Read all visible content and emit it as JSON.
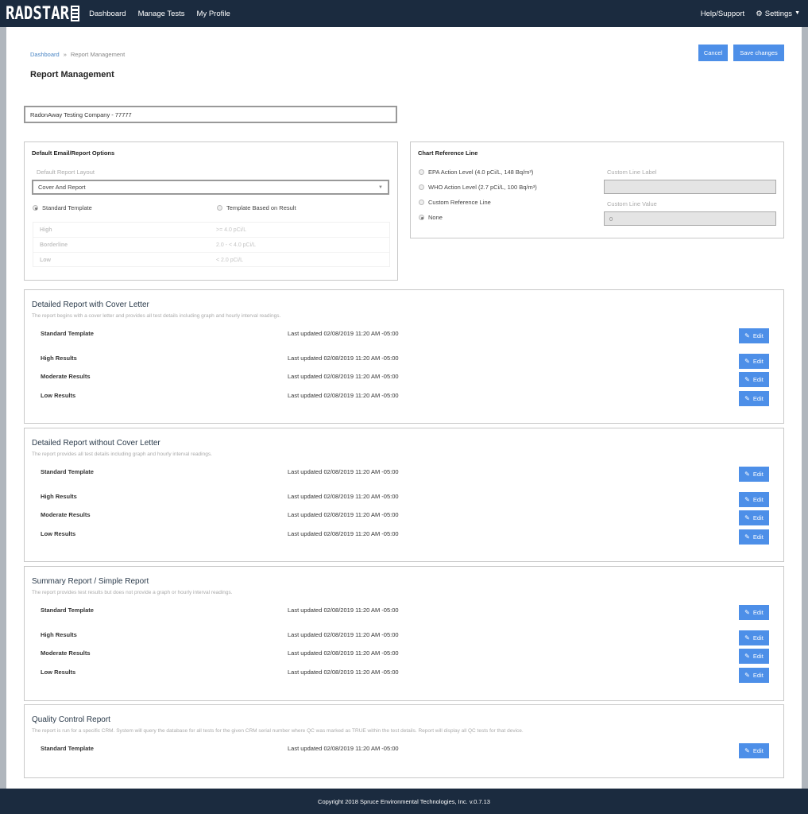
{
  "navbar": {
    "logo_text": "RADSTAR",
    "links": [
      "Dashboard",
      "Manage Tests",
      "My Profile"
    ],
    "help_label": "Help/Support",
    "settings_label": "Settings"
  },
  "breadcrumb": {
    "home": "Dashboard",
    "separator": "»",
    "current": "Report Management"
  },
  "page_title": "Report Management",
  "actions": {
    "cancel_label": "Cancel",
    "save_label": "Save changes"
  },
  "company_field": {
    "value": "RadonAway Testing Company - 77777"
  },
  "email_options": {
    "title": "Default Email/Report Options",
    "layout_label": "Default Report Layout",
    "layout_value": "Cover And Report",
    "radio_standard": "Standard Template",
    "radio_result_based": "Template Based on Result",
    "selected": "Standard Template",
    "thresholds": [
      {
        "name": "High",
        "value": ">= 4.0 pCi/L"
      },
      {
        "name": "Borderline",
        "value": "2.0 - < 4.0 pCi/L"
      },
      {
        "name": "Low",
        "value": "< 2.0 pCi/L"
      }
    ]
  },
  "chart_reference": {
    "title": "Chart Reference Line",
    "options": [
      "EPA Action Level (4.0 pCi/L, 148 Bq/m³)",
      "WHO Action Level (2.7 pCi/L, 100 Bq/m³)",
      "Custom Reference Line",
      "None"
    ],
    "selected": "None",
    "custom_label_label": "Custom Line Label",
    "custom_label_value": "",
    "custom_value_label": "Custom Line Value",
    "custom_value_value": "0"
  },
  "reports": [
    {
      "title": "Detailed Report with Cover Letter",
      "description": "The report begins with a cover letter and provides all test details including graph and hourly interval readings.",
      "templates": [
        {
          "name": "Standard Template",
          "updated": "Last updated 02/08/2019 11:20 AM -05:00"
        },
        {
          "name": "High Results",
          "updated": "Last updated 02/08/2019 11:20 AM -05:00"
        },
        {
          "name": "Moderate Results",
          "updated": "Last updated 02/08/2019 11:20 AM -05:00"
        },
        {
          "name": "Low Results",
          "updated": "Last updated 02/08/2019 11:20 AM -05:00"
        }
      ]
    },
    {
      "title": "Detailed Report without Cover Letter",
      "description": "The report provides all test details including graph and hourly interval readings.",
      "templates": [
        {
          "name": "Standard Template",
          "updated": "Last updated 02/08/2019 11:20 AM -05:00"
        },
        {
          "name": "High Results",
          "updated": "Last updated 02/08/2019 11:20 AM -05:00"
        },
        {
          "name": "Moderate Results",
          "updated": "Last updated 02/08/2019 11:20 AM -05:00"
        },
        {
          "name": "Low Results",
          "updated": "Last updated 02/08/2019 11:20 AM -05:00"
        }
      ]
    },
    {
      "title": "Summary Report / Simple Report",
      "description": "The report provides test results but does not provide a graph or hourly interval readings.",
      "templates": [
        {
          "name": "Standard Template",
          "updated": "Last updated 02/08/2019 11:20 AM -05:00"
        },
        {
          "name": "High Results",
          "updated": "Last updated 02/08/2019 11:20 AM -05:00"
        },
        {
          "name": "Moderate Results",
          "updated": "Last updated 02/08/2019 11:20 AM -05:00"
        },
        {
          "name": "Low Results",
          "updated": "Last updated 02/08/2019 11:20 AM -05:00"
        }
      ]
    },
    {
      "title": "Quality Control Report",
      "description": "The report is run for a specific CRM. System will query the database for all tests for the given CRM serial number where QC was marked as TRUE within the test details. Report will display all QC tests for that device.",
      "templates": [
        {
          "name": "Standard Template",
          "updated": "Last updated 02/08/2019 11:20 AM -05:00"
        }
      ]
    }
  ],
  "edit_label": "Edit",
  "footer": {
    "text": "Copyright 2018 Spruce Environmental Technologies, Inc. v.0.7.13"
  },
  "colors": {
    "navbar": "#1b2b3f",
    "primary_button": "#4d8fe8",
    "link": "#4a86c5"
  }
}
